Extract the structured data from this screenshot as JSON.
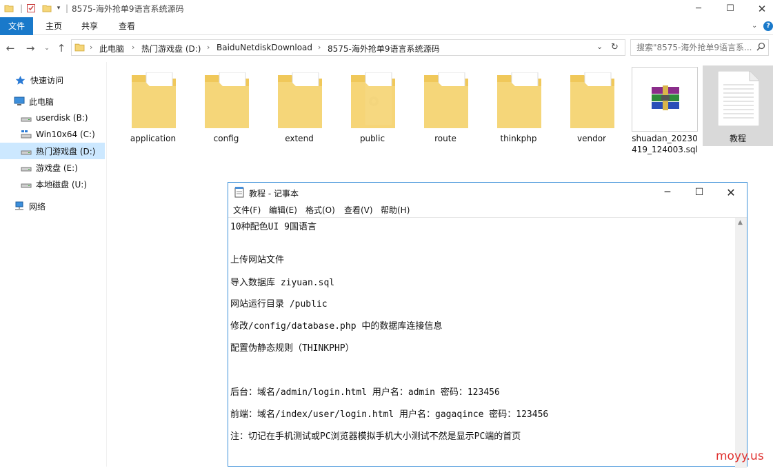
{
  "window": {
    "title": "8575-海外抢单9语言系统源码"
  },
  "ribbon": {
    "tabs": [
      "文件",
      "主页",
      "共享",
      "查看"
    ]
  },
  "address": {
    "crumbs": [
      "此电脑",
      "热门游戏盘 (D:)",
      "BaiduNetdiskDownload",
      "8575-海外抢单9语言系统源码"
    ]
  },
  "search": {
    "placeholder": "搜索\"8575-海外抢单9语言系..."
  },
  "sidebar": {
    "items": [
      {
        "label": "快速访问",
        "icon": "star-icon"
      },
      {
        "label": "此电脑",
        "icon": "computer-icon"
      },
      {
        "label": "userdisk (B:)",
        "icon": "drive-icon"
      },
      {
        "label": "Win10x64 (C:)",
        "icon": "windows-drive-icon"
      },
      {
        "label": "热门游戏盘 (D:)",
        "icon": "drive-icon"
      },
      {
        "label": "游戏盘 (E:)",
        "icon": "drive-icon"
      },
      {
        "label": "本地磁盘 (U:)",
        "icon": "drive-icon"
      },
      {
        "label": "网络",
        "icon": "network-icon"
      }
    ]
  },
  "files": [
    {
      "name": "application",
      "type": "folder"
    },
    {
      "name": "config",
      "type": "folder"
    },
    {
      "name": "extend",
      "type": "folder"
    },
    {
      "name": "public",
      "type": "folder"
    },
    {
      "name": "route",
      "type": "folder"
    },
    {
      "name": "thinkphp",
      "type": "folder"
    },
    {
      "name": "vendor",
      "type": "folder"
    },
    {
      "name": "shuadan_20230419_124003.sql",
      "name_line1": "shuadan_20230",
      "name_line2": "419_124003.sql",
      "type": "archive"
    },
    {
      "name": "教程",
      "type": "text"
    }
  ],
  "notepad": {
    "title": "教程 - 记事本",
    "menu": [
      "文件(F)",
      "编辑(E)",
      "格式(O)",
      "查看(V)",
      "帮助(H)"
    ],
    "lines": [
      "10种配色UI 9国语言",
      "上传网站文件",
      "导入数据库 ziyuan.sql",
      "网站运行目录 /public",
      "修改/config/database.php 中的数据库连接信息",
      "配置伪静态规则（THINKPHP）",
      "后台：域名/admin/login.html  用户名：admin  密码：123456",
      "前端：域名/index/user/login.html  用户名：gagaqince 密码：123456",
      "注：切记在手机测试或PC浏览器模拟手机大小测试不然是显示PC端的首页"
    ]
  },
  "watermark": "moyy.us",
  "colors": {
    "accent": "#1979ca",
    "folder": "#f5d679",
    "watermark": "#e0312f"
  }
}
